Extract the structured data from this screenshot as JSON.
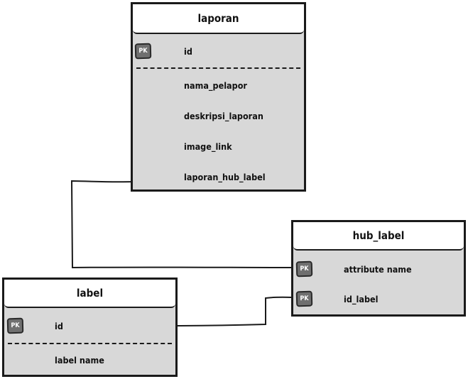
{
  "pk_badge": "PK",
  "laporan": {
    "title": "laporan",
    "pk_field": "id",
    "fields": [
      "nama_pelapor",
      "deskripsi_laporan",
      "image_link",
      "laporan_hub_label"
    ]
  },
  "hub_label": {
    "title": "hub_label",
    "fields": [
      "attribute name",
      "id_label"
    ]
  },
  "label": {
    "title": "label",
    "pk_field": "id",
    "fields": [
      "label name"
    ]
  },
  "colors": {
    "entity_fill": "#d8d8d8",
    "header_fill": "#ffffff",
    "border": "#1a1a1a",
    "pk_badge": "#6f6f6f"
  }
}
